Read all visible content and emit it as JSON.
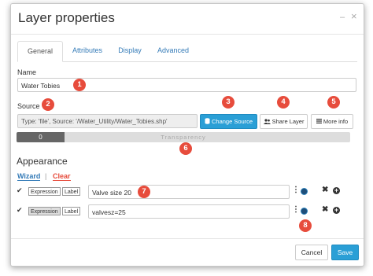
{
  "dialog": {
    "title": "Layer properties",
    "controls": {
      "minimize": "–",
      "close": "×"
    }
  },
  "tabs": [
    {
      "label": "General"
    },
    {
      "label": "Attributes"
    },
    {
      "label": "Display"
    },
    {
      "label": "Advanced"
    }
  ],
  "general": {
    "name_label": "Name",
    "name_value": "Water Tobies",
    "source_label": "Source",
    "source_value": "Type: 'file', Source: '/Water_Utility/Water_Tobies.shp'",
    "change_source_label": "Change Source",
    "share_layer_label": "Share Layer",
    "more_info_label": "More info",
    "transparency_value": "0",
    "transparency_label": "Transparency"
  },
  "appearance": {
    "title": "Appearance",
    "wizard_label": "Wizard",
    "separator": "|",
    "clear_label": "Clear",
    "rows": [
      {
        "expression_tag": "Expression",
        "label_tag": "Label",
        "value": "Valve size 20"
      },
      {
        "expression_tag": "Expression",
        "label_tag": "Label",
        "value": "valvesz=25"
      }
    ]
  },
  "footer": {
    "cancel_label": "Cancel",
    "save_label": "Save"
  },
  "callouts": [
    "1",
    "2",
    "3",
    "4",
    "5",
    "6",
    "7",
    "8"
  ],
  "colors": {
    "accent": "#2a9fd6",
    "link": "#337ab7",
    "callout": "#e74c3c",
    "clear": "#e74c3c"
  }
}
